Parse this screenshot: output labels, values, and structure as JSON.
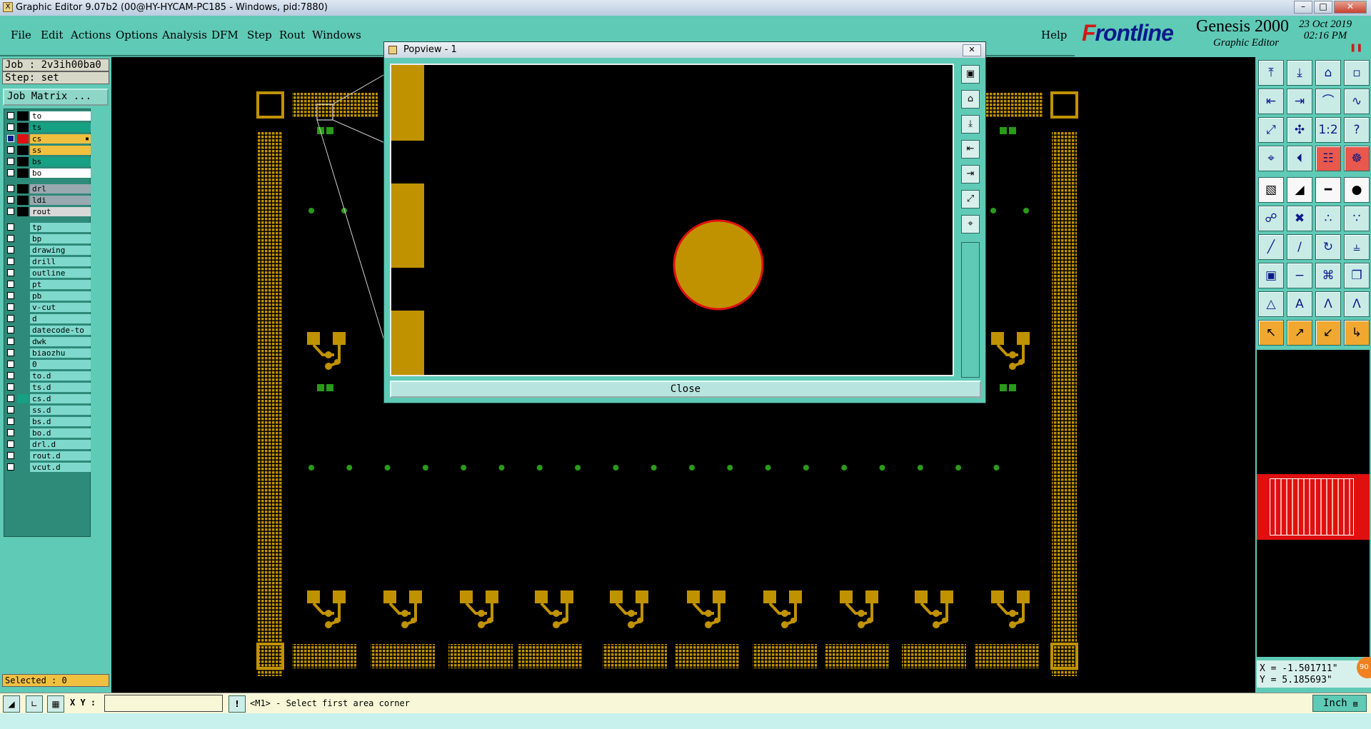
{
  "window": {
    "title": "Graphic Editor 9.07b2 (00@HY-HYCAM-PC185 - Windows, pid:7880)",
    "app_icon": "x-icon",
    "controls": [
      "minimize-icon",
      "maximize-icon",
      "close-icon"
    ]
  },
  "menu": {
    "items": [
      "File",
      "Edit",
      "Actions",
      "Options",
      "Analysis",
      "DFM",
      "Step",
      "Rout",
      "Windows"
    ],
    "help": "Help"
  },
  "brand": {
    "logo_prefix": "F",
    "logo_rest": "rontline",
    "product": "Genesis 2000",
    "subtitle": "Graphic Editor",
    "date": "23 Oct 2019",
    "time": "02:16 PM",
    "colors": {
      "logo_blue": "#0a1a8a",
      "logo_red": "#d01818"
    }
  },
  "job": {
    "job_label": "Job : 2v3ih00ba0",
    "step_label": "Step: set",
    "matrix_button": "Job Matrix ..."
  },
  "layers": [
    {
      "name": "to",
      "color": "#ffffff",
      "active": false,
      "swatch": "#000000"
    },
    {
      "name": "ts",
      "color": "#16a084",
      "active": false,
      "swatch": "#000000"
    },
    {
      "name": "cs",
      "color": "#f0c040",
      "active": true,
      "swatch": "#e01010",
      "marker": "▪"
    },
    {
      "name": "ss",
      "color": "#f0c040",
      "active": false,
      "swatch": "#000000"
    },
    {
      "name": "bs",
      "color": "#16a084",
      "active": false,
      "swatch": "#000000"
    },
    {
      "name": "bo",
      "color": "#ffffff",
      "active": false,
      "swatch": "#000000"
    },
    {
      "name": "drl",
      "color": "#9aa8b0",
      "active": false,
      "swatch": "#000000",
      "group": 2
    },
    {
      "name": "ldi",
      "color": "#9aa8b0",
      "active": false,
      "swatch": "#000000",
      "group": 2
    },
    {
      "name": "rout",
      "color": "#d8d8d8",
      "active": false,
      "swatch": "#000000",
      "group": 2
    },
    {
      "name": "tp",
      "color": "#7ed8cc",
      "group": 3
    },
    {
      "name": "bp",
      "color": "#7ed8cc",
      "group": 3
    },
    {
      "name": "drawing",
      "color": "#7ed8cc",
      "group": 3
    },
    {
      "name": "drill",
      "color": "#7ed8cc",
      "group": 3
    },
    {
      "name": "outline",
      "color": "#7ed8cc",
      "group": 3
    },
    {
      "name": "pt",
      "color": "#7ed8cc",
      "group": 3
    },
    {
      "name": "pb",
      "color": "#7ed8cc",
      "group": 3
    },
    {
      "name": "v-cut",
      "color": "#7ed8cc",
      "group": 3
    },
    {
      "name": "d",
      "color": "#7ed8cc",
      "group": 3
    },
    {
      "name": "datecode-to",
      "color": "#7ed8cc",
      "group": 3
    },
    {
      "name": "dwk",
      "color": "#7ed8cc",
      "group": 3
    },
    {
      "name": "biaozhu",
      "color": "#7ed8cc",
      "group": 3
    },
    {
      "name": "0",
      "color": "#7ed8cc",
      "group": 3
    },
    {
      "name": "to.d",
      "color": "#7ed8cc",
      "group": 3
    },
    {
      "name": "ts.d",
      "color": "#7ed8cc",
      "group": 3
    },
    {
      "name": "cs.d",
      "color": "#7ed8cc",
      "group": 3,
      "swatch": "#16a084"
    },
    {
      "name": "ss.d",
      "color": "#7ed8cc",
      "group": 3
    },
    {
      "name": "bs.d",
      "color": "#7ed8cc",
      "group": 3
    },
    {
      "name": "bo.d",
      "color": "#7ed8cc",
      "group": 3
    },
    {
      "name": "drl.d",
      "color": "#7ed8cc",
      "group": 3
    },
    {
      "name": "rout.d",
      "color": "#7ed8cc",
      "group": 3
    },
    {
      "name": "vcut.d",
      "color": "#7ed8cc",
      "group": 3
    }
  ],
  "selected_label": "Selected : 0",
  "popview": {
    "title": "Popview - 1",
    "close_label": "Close",
    "tools": [
      "fit-icon",
      "zoom-in-icon",
      "zoom-out-icon",
      "pan-left-icon",
      "pan-right-icon",
      "zoom-area-icon",
      "snap-icon"
    ]
  },
  "canvas_colors": {
    "background": "#000000",
    "copper": "#c09200",
    "highlight": "#e01010",
    "via": "#2a9a1a"
  },
  "toolbox_icons": [
    [
      "home-up-icon",
      "home-down-icon",
      "house-icon",
      "window-icon"
    ],
    [
      "pan-left-icon",
      "pan-right-icon",
      "arc-icon",
      "s-curve-icon"
    ],
    [
      "fit-icon",
      "fit-all-icon",
      "one-to-one-icon",
      "help-icon"
    ],
    [
      "snap-icon",
      "measure-icon",
      "red-grid-icon",
      "red-grid2-icon"
    ],
    [
      "bitmap-icon",
      "polygon-icon",
      "ruler-icon",
      "pad-icon"
    ],
    [
      "node-icon",
      "cross-icon",
      "connect-icon",
      "connect2-icon"
    ],
    [
      "line-icon",
      "line2-icon",
      "rotate-icon",
      "split-icon"
    ],
    [
      "move-pad-icon",
      "minus-icon",
      "symbol-icon",
      "copy-icon"
    ],
    [
      "triangle-icon",
      "a-icon",
      "a-frame-icon",
      "a-outline-icon"
    ],
    [
      "pointer-icon",
      "pointer2-icon",
      "pointer3-icon",
      "route-icon"
    ]
  ],
  "coords": {
    "x": "X = -1.501711\"",
    "y": "Y = 5.185693\""
  },
  "bottom": {
    "xy_label": "X Y :",
    "xy_value": "",
    "prompt": "<M1> - Select first area corner",
    "units": "Inch"
  }
}
